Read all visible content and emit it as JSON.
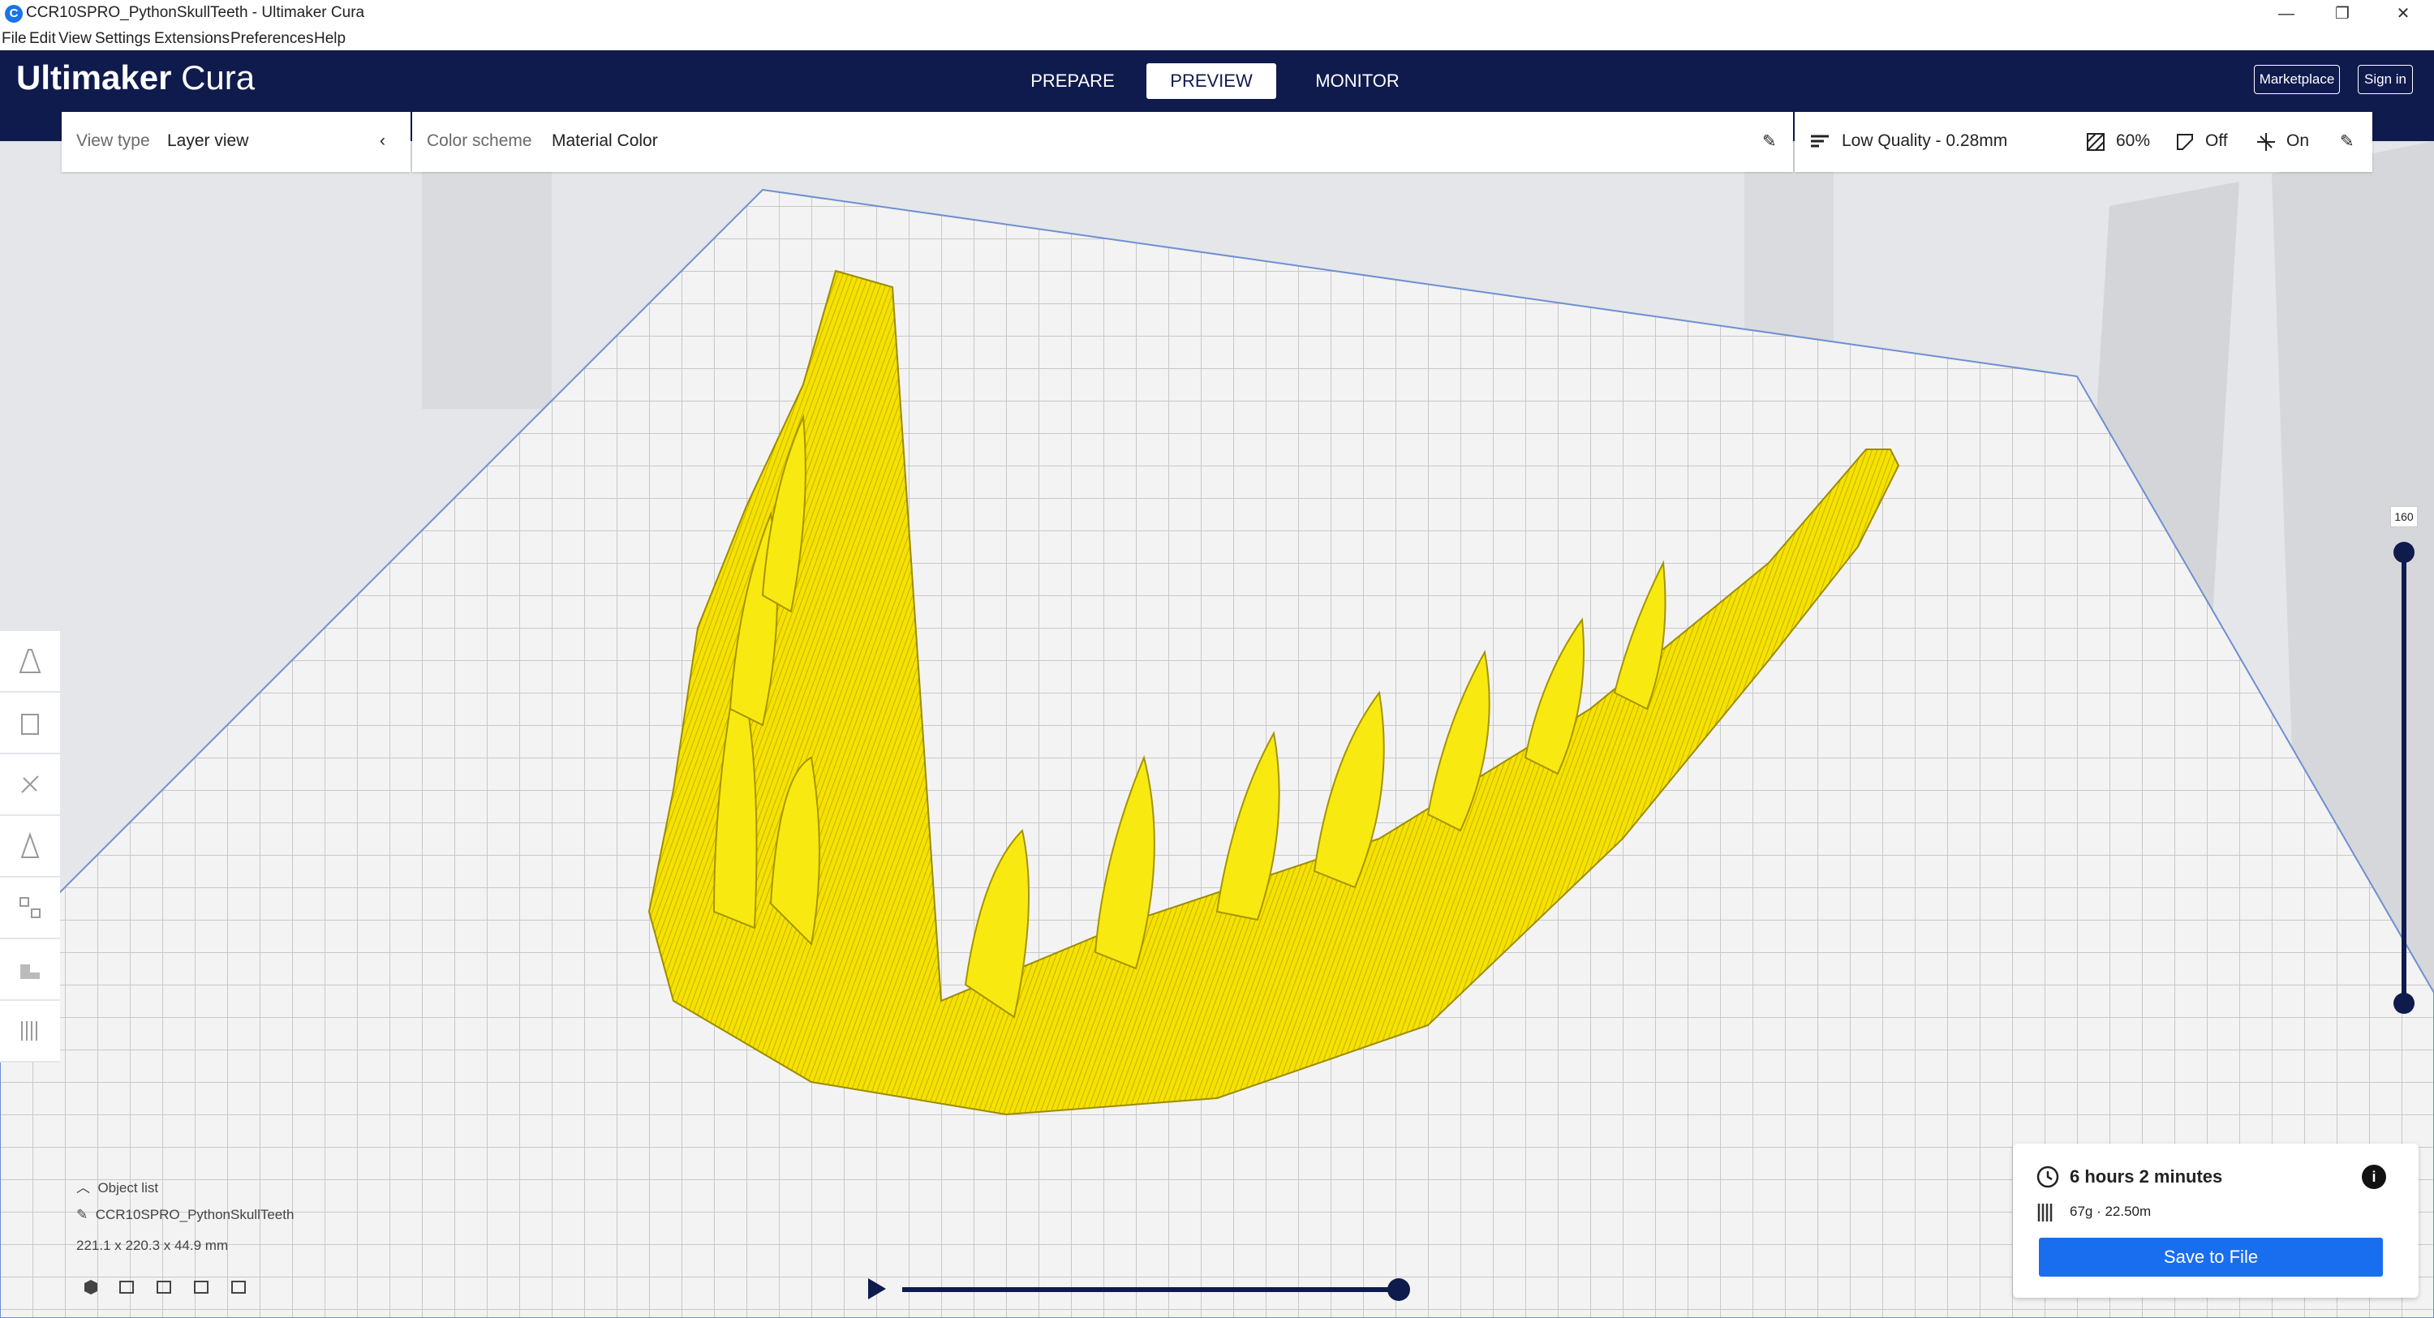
{
  "window": {
    "title": "CCR10SPRO_PythonSkullTeeth - Ultimaker Cura",
    "app_icon": "C",
    "minimize": "—",
    "restore": "❐",
    "close": "✕"
  },
  "menu": [
    "File",
    "Edit",
    "View",
    "Settings",
    "Extensions",
    "Preferences",
    "Help"
  ],
  "header": {
    "logo_bold": "Ultimaker",
    "logo_light": "Cura",
    "stages": [
      "PREPARE",
      "PREVIEW",
      "MONITOR"
    ],
    "active_stage": "PREVIEW",
    "marketplace": "Marketplace",
    "sign_in": "Sign in"
  },
  "view_panel": {
    "view_type_label": "View type",
    "view_type_value": "Layer view"
  },
  "color_panel": {
    "label": "Color scheme",
    "value": "Material Color"
  },
  "print_settings": {
    "profile": "Low Quality - 0.28mm",
    "infill": "60%",
    "support": "Off",
    "adhesion": "On"
  },
  "layer_slider": {
    "max_layer": "160"
  },
  "object_list": {
    "header": "Object list",
    "object_name": "CCR10SPRO_PythonSkullTeeth",
    "dimensions": "221.1 x 220.3 x 44.9 mm"
  },
  "print_info": {
    "time": "6 hours 2 minutes",
    "material": "67g · 22.50m",
    "save_button": "Save to File"
  },
  "colors": {
    "header_bg": "#0f1b4d",
    "accent_blue": "#196ef0",
    "model_yellow": "#f5e400",
    "viewport_bg": "#e4e6ea"
  }
}
